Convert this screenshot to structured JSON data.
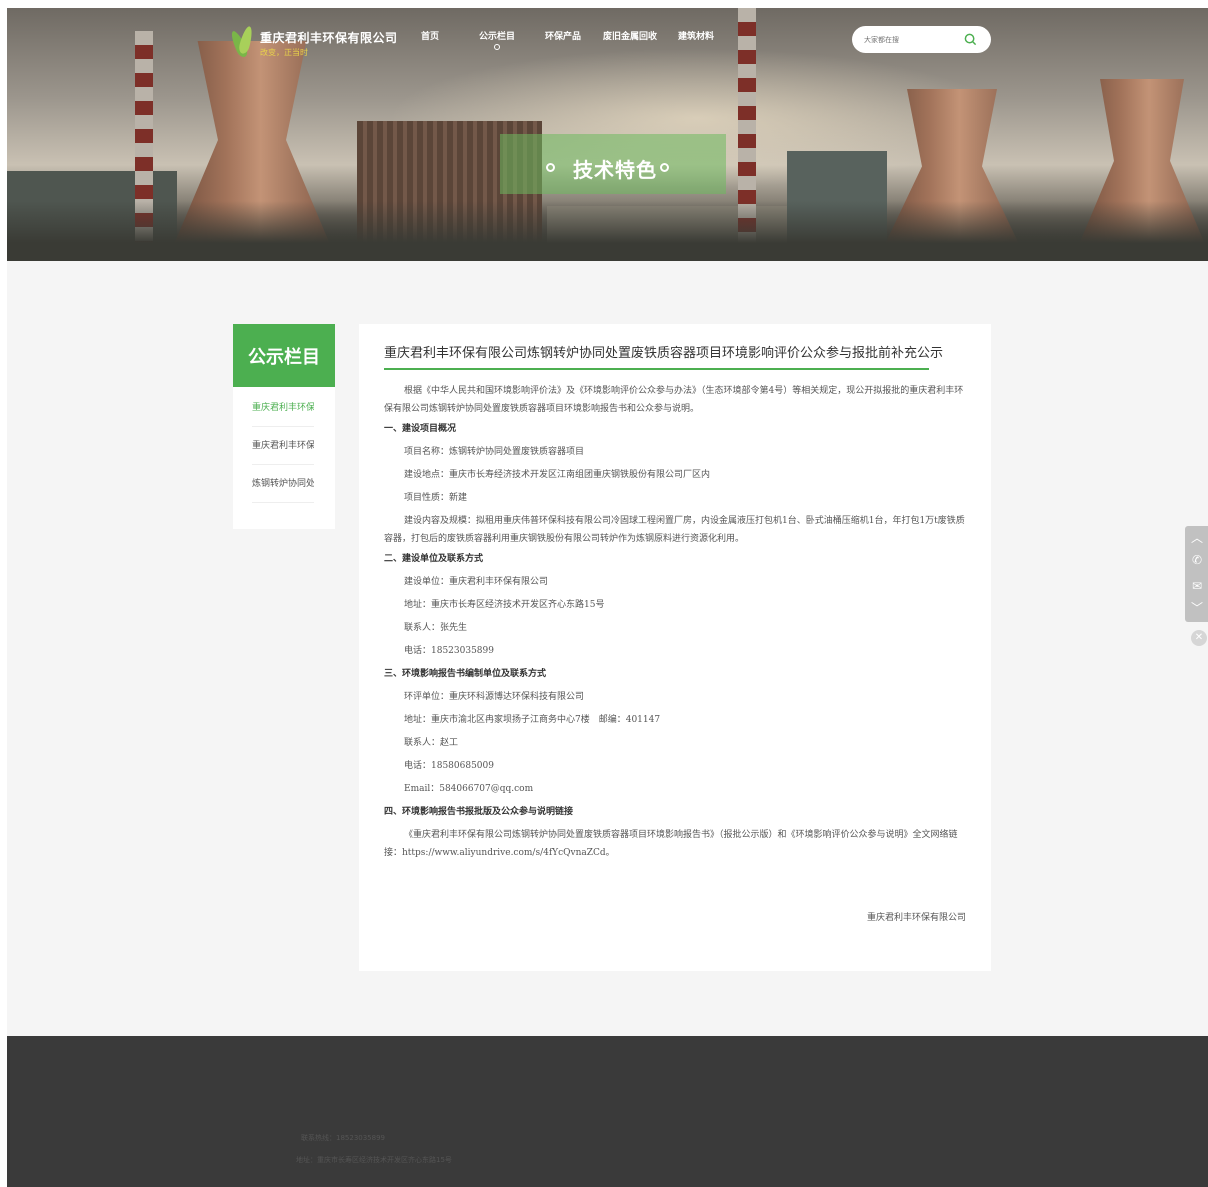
{
  "header": {
    "company": "重庆君利丰环保有限公司",
    "slogan": "改变，正当时",
    "nav": [
      "首页",
      "公示栏目",
      "环保产品",
      "废旧金属回收",
      "建筑材料"
    ],
    "active_nav": "公示栏目",
    "search_placeholder": "大家都在搜"
  },
  "banner": {
    "title": "技术特色"
  },
  "sidebar": {
    "heading": "公示栏目",
    "items": [
      {
        "label": "重庆君利丰环保"
      },
      {
        "label": "重庆君利丰环保"
      },
      {
        "label": "炼钢转炉协同处"
      }
    ]
  },
  "article": {
    "title": "重庆君利丰环保有限公司炼钢转炉协同处置废铁质容器项目环境影响评价公众参与报批前补充公示",
    "intro": "根据《中华人民共和国环境影响评价法》及《环境影响评价公众参与办法》（生态环境部令第4号）等相关规定，现公开拟报批的重庆君利丰环保有限公司炼钢转炉协同处置废铁质容器项目环境影响报告书和公众参与说明。",
    "s1_heading": "一、建设项目概况",
    "s1_name": "项目名称：炼钢转炉协同处置废铁质容器项目",
    "s1_location": "建设地点：重庆市长寿经济技术开发区江南组团重庆钢铁股份有限公司厂区内",
    "s1_nature": "项目性质：新建",
    "s1_content": "建设内容及规模：拟租用重庆伟普环保科技有限公司冷固球工程闲置厂房，内设金属液压打包机1台、卧式油桶压缩机1台，年打包1万t废铁质容器，打包后的废铁质容器利用重庆钢铁股份有限公司转炉作为炼钢原料进行资源化利用。",
    "s2_heading": "二、建设单位及联系方式",
    "s2_unit": "建设单位：重庆君利丰环保有限公司",
    "s2_address": "地址：重庆市长寿区经济技术开发区齐心东路15号",
    "s2_contact": "联系人：张先生",
    "s2_phone": "电话：18523035899",
    "s3_heading": "三、环境影响报告书编制单位及联系方式",
    "s3_unit": "环评单位：重庆环科源博达环保科技有限公司",
    "s3_address": "地址：重庆市渝北区冉家坝扬子江商务中心7楼　邮编：401147",
    "s3_contact": "联系人：赵工",
    "s3_phone": "电话：18580685009",
    "s3_email": "Email：584066707@qq.com",
    "s4_heading": "四、环境影响报告书报批版及公众参与说明链接",
    "s4_text": "《重庆君利丰环保有限公司炼钢转炉协同处置废铁质容器项目环境影响报告书》（报批公示版）和《环境影响评价公众参与说明》全文网络链接：https://www.aliyundrive.com/s/4fYcQvnaZCd。",
    "signature": "重庆君利丰环保有限公司"
  },
  "footer": {
    "hotline": "联系热线：18523035899",
    "address": "地址：重庆市长寿区经济技术开发区齐心东路15号"
  },
  "colors": {
    "accent": "#4caf50",
    "footer_bg": "#3a3a3a",
    "page_bg": "#f5f5f5"
  },
  "icons": [
    "search-icon",
    "arrow-up-icon",
    "phone-icon",
    "mail-icon",
    "arrow-down-icon",
    "close-icon"
  ]
}
